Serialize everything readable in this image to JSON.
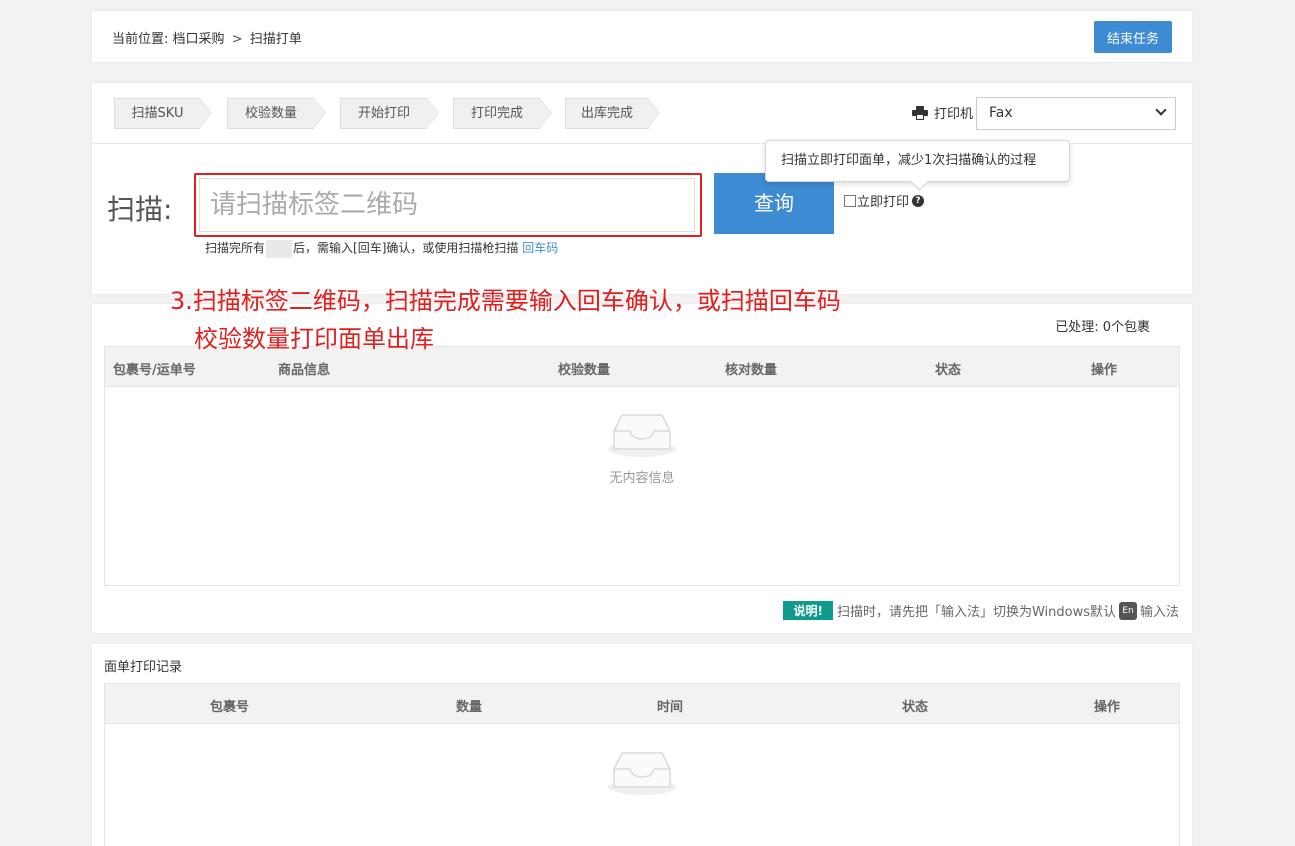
{
  "breadcrumb": {
    "prefix": "当前位置:",
    "parent": "档口采购",
    "separator": ">",
    "current": "扫描打单"
  },
  "end_task_label": "结束任务",
  "steps": [
    "扫描SKU",
    "校验数量",
    "开始打印",
    "打印完成",
    "出库完成"
  ],
  "printer": {
    "label": "打印机",
    "selected": "Fax",
    "icon": "printer-icon"
  },
  "scan": {
    "label": "扫描:",
    "placeholder": "请扫描标签二维码",
    "query_label": "查询",
    "hint_prefix": "扫描完所有",
    "hint_middle": "后，需输入[回车]确认，或使用扫描枪扫描",
    "hint_link": "回车码",
    "immediate_print_label": "立即打印",
    "tooltip": "扫描立即打印面单，减少1次扫描确认的过程"
  },
  "annotation": {
    "line1": "3.扫描标签二维码，扫描完成需要输入回车确认，或扫描回车码",
    "line2": "校验数量打印面单出库"
  },
  "package_table": {
    "processed_label": "已处理:",
    "processed_value": "0个包裹",
    "columns": [
      "包裹号/运单号",
      "商品信息",
      "校验数量",
      "核对数量",
      "状态",
      "操作"
    ],
    "empty_text": "无内容信息"
  },
  "note": {
    "badge": "说明!",
    "text_before": "扫描时，请先把「输入法」切换为Windows默认",
    "en_badge": "En",
    "text_after": "输入法"
  },
  "record": {
    "title": "面单打印记录",
    "columns": [
      "包裹号",
      "数量",
      "时间",
      "状态",
      "操作"
    ]
  },
  "colors": {
    "accent": "#3d8bd3",
    "annotation_red": "#e02020",
    "note_badge": "#0f9a8c"
  }
}
